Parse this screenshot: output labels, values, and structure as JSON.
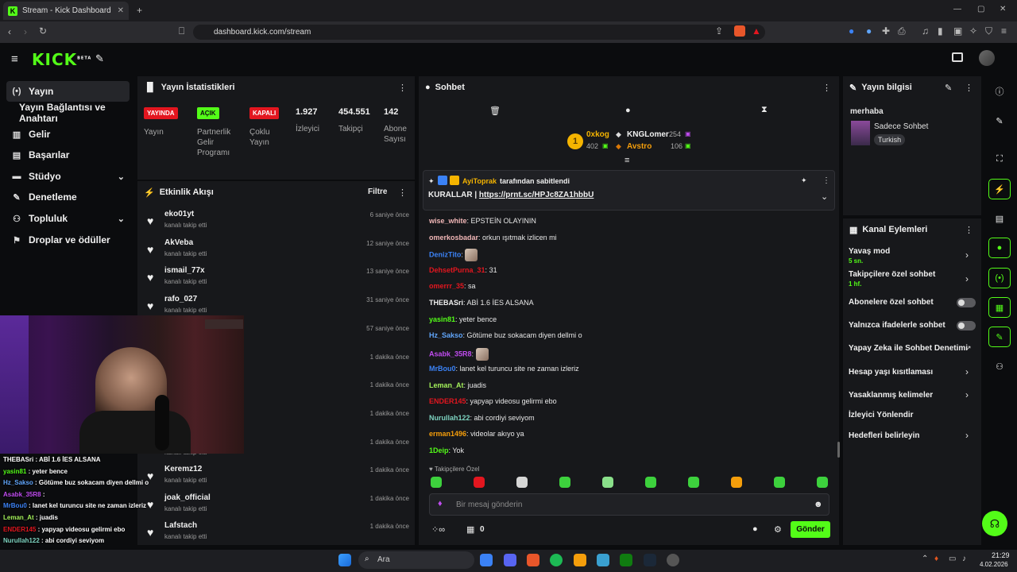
{
  "browser": {
    "tab_title": "Stream - Kick Dashboard",
    "url": "dashboard.kick.com/stream"
  },
  "header": {
    "logo": "KICK",
    "logo_badge": "BETA"
  },
  "nav": {
    "items": [
      {
        "label": "Yayın",
        "icon": "broadcast-icon"
      },
      {
        "label": "Yayın Bağlantısı ve Anahtarı",
        "icon": ""
      },
      {
        "label": "Gelir",
        "icon": "chart-icon"
      },
      {
        "label": "Başarılar",
        "icon": "trophy-icon"
      },
      {
        "label": "Stüdyo",
        "icon": "studio-icon"
      },
      {
        "label": "Denetleme",
        "icon": "wrench-icon"
      },
      {
        "label": "Topluluk",
        "icon": "people-icon"
      },
      {
        "label": "Droplar ve ödüller",
        "icon": "gift-icon"
      }
    ]
  },
  "stats": {
    "title": "Yayın İstatistikleri",
    "badges": [
      {
        "badge": "YAYINDA",
        "label": "Yayın",
        "color": "#e3161f"
      },
      {
        "badge": "AÇIK",
        "label": "Partnerlik Gelir Programı",
        "color": "#53fc18"
      },
      {
        "badge": "KAPALI",
        "label": "Çoklu Yayın",
        "color": "#e3161f"
      }
    ],
    "viewers": {
      "value": "1.927",
      "label": "İzleyici"
    },
    "followers": {
      "value": "454.551",
      "label": "Takipçi"
    },
    "subs": {
      "value": "142",
      "label": "Abone Sayısı"
    }
  },
  "activity": {
    "title": "Etkinlik Akışı",
    "filter": "Filtre",
    "items": [
      {
        "name": "eko01yt",
        "sub": "kanalı takip etti",
        "time": "6 saniye önce"
      },
      {
        "name": "AkVeba",
        "sub": "kanalı takip etti",
        "time": "12 saniye önce"
      },
      {
        "name": "ismail_77x",
        "sub": "kanalı takip etti",
        "time": "13 saniye önce"
      },
      {
        "name": "rafo_027",
        "sub": "kanalı takip etti",
        "time": "31 saniye önce"
      },
      {
        "name": "",
        "sub": "",
        "time": "57 saniye önce"
      },
      {
        "name": "",
        "sub": "",
        "time": "1 dakika önce"
      },
      {
        "name": "",
        "sub": "",
        "time": "1 dakika önce"
      },
      {
        "name": "",
        "sub": "",
        "time": "1 dakika önce"
      },
      {
        "name": "",
        "sub": "kanalı takip etti",
        "time": "1 dakika önce"
      },
      {
        "name": "Keremz12",
        "sub": "kanalı takip etti",
        "time": "1 dakika önce"
      },
      {
        "name": "joak_official",
        "sub": "kanalı takip etti",
        "time": "1 dakika önce"
      },
      {
        "name": "Lafstach",
        "sub": "kanalı takip etti",
        "time": "1 dakika önce"
      }
    ]
  },
  "chat": {
    "title": "Sohbet",
    "leaders": [
      {
        "name": "0xkog",
        "value": "402"
      },
      {
        "name": "KNGLomer",
        "value": "254"
      },
      {
        "name": "Avstro",
        "value": "106"
      }
    ],
    "pinned": {
      "by": "AyiToprak",
      "by_suffix": "tarafından sabitlendi",
      "text_prefix": "KURALLAR | ",
      "link": "https://prnt.sc/HPJc8ZA1hbbU"
    },
    "messages": [
      {
        "user": "wise_white",
        "color": "#f0b6b6",
        "text": "EPSTEİN OLAYININ"
      },
      {
        "user": "omerkosbadar",
        "color": "#f0b6b6",
        "text": "orkun ışıtmak izlicen mi"
      },
      {
        "user": "DenizTito",
        "color": "#3b82f6",
        "text": ""
      },
      {
        "user": "DehsetPurna_31",
        "color": "#e3161f",
        "text": "31"
      },
      {
        "user": "omerrr_35",
        "color": "#e3161f",
        "text": "sa"
      },
      {
        "user": "THEBASri",
        "color": "#f0f0f0",
        "text": "ABİ 1.6 İES ALSANA"
      },
      {
        "user": "yasin81",
        "color": "#53fc18",
        "text": "yeter bence"
      },
      {
        "user": "Hz_Sakso",
        "color": "#60a5fa",
        "text": "Götüme buz sokacam diyen dellmi o"
      },
      {
        "user": "Asabk_35R8",
        "color": "#c04cf0",
        "text": ""
      },
      {
        "user": "MrBou0",
        "color": "#3b82f6",
        "text": "lanet kel turuncu site ne zaman izleriz"
      },
      {
        "user": "Leman_At",
        "color": "#a3f05a",
        "text": "juadis"
      },
      {
        "user": "ENDER145",
        "color": "#e3161f",
        "text": "yapyap videosu gelirmi ebo"
      },
      {
        "user": "Nurullah122",
        "color": "#7dd3c0",
        "text": "abi cordiyi seviyom"
      },
      {
        "user": "erman1496",
        "color": "#f59e0b",
        "text": "videolar akıyo ya"
      },
      {
        "user": "1Deip",
        "color": "#53fc18",
        "text": "Yok"
      }
    ],
    "followers_only": "Takipçilere Özel",
    "input_placeholder": "Bir mesaj gönderin",
    "send": "Gönder",
    "points": "0"
  },
  "info": {
    "title": "Yayın bilgisi",
    "stream_title": "merhaba",
    "category": "Sadece Sohbet",
    "language": "Turkish"
  },
  "actions": {
    "title": "Kanal Eylemleri",
    "slow": {
      "label": "Yavaş mod",
      "sub": "5 sn."
    },
    "followers_chat": {
      "label": "Takipçilere özel sohbet",
      "sub": "1 hf."
    },
    "subs_chat": "Abonelere özel sohbet",
    "emote_chat": "Yalnızca ifadelerle sohbet",
    "ai_mod": "Yapay Zeka ile Sohbet Denetimi",
    "age": "Hesap yaşı kısıtlaması",
    "banned": "Yasaklanmış kelimeler",
    "redirect": "İzleyici Yönlendir",
    "goals": "Hedefleri belirleyin"
  },
  "overlay_chat": [
    {
      "user": "THEBASri",
      "color": "#ffffff",
      "text": "ABİ 1.6 İES ALSANA"
    },
    {
      "user": "yasin81",
      "color": "#53fc18",
      "text": "yeter bence"
    },
    {
      "user": "Hz_Sakso",
      "color": "#60a5fa",
      "text": "Götüme buz sokacam diyen dellmi o"
    },
    {
      "user": "Asabk_35R8",
      "color": "#c04cf0",
      "text": ""
    },
    {
      "user": "MrBou0",
      "color": "#3b82f6",
      "text": "lanet kel turuncu site ne zaman izleriz"
    },
    {
      "user": "Leman_At",
      "color": "#a3f05a",
      "text": "juadis"
    },
    {
      "user": "ENDER145",
      "color": "#e3161f",
      "text": "yapyap videosu gelirmi ebo"
    },
    {
      "user": "Nurullah122",
      "color": "#7dd3c0",
      "text": "abi cordiyi seviyom"
    },
    {
      "user": "erman1496",
      "color": "#f59e0b",
      "text": "videolar akıyo ya"
    },
    {
      "user": "1Deip",
      "color": "#53fc18",
      "text": "Yok"
    }
  ],
  "taskbar": {
    "search": "Ara",
    "time": "21:29",
    "date": "4.02.2026"
  }
}
